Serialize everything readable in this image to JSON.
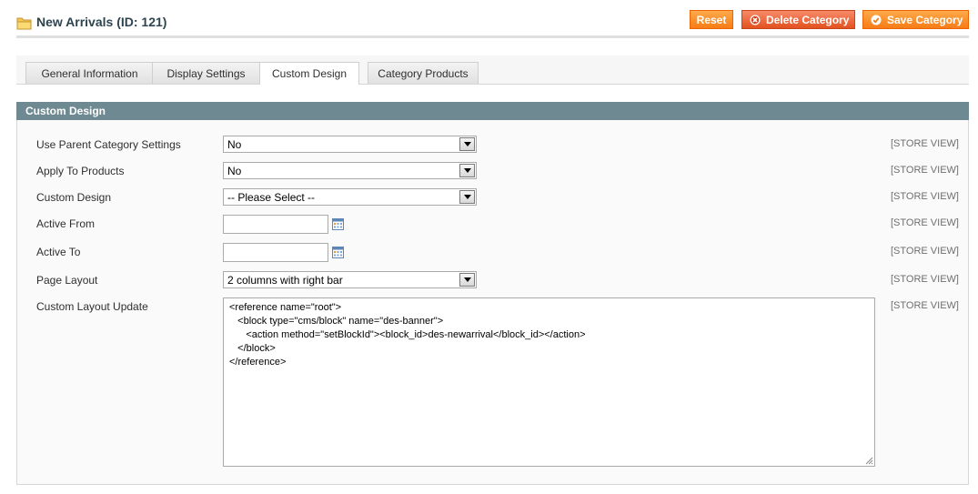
{
  "header": {
    "title": "New Arrivals (ID: 121)",
    "title_icon": "folder-icon",
    "buttons": {
      "reset": "Reset",
      "delete": "Delete Category",
      "save": "Save Category"
    }
  },
  "tabs": [
    {
      "label": "General Information",
      "active": false
    },
    {
      "label": "Display Settings",
      "active": false
    },
    {
      "label": "Custom Design",
      "active": true
    },
    {
      "label": "Category Products",
      "active": false
    }
  ],
  "section": {
    "title": "Custom Design",
    "scope_label": "[STORE VIEW]",
    "fields": {
      "use_parent": {
        "label": "Use Parent Category Settings",
        "value": "No"
      },
      "apply_products": {
        "label": "Apply To Products",
        "value": "No"
      },
      "custom_design": {
        "label": "Custom Design",
        "value": "-- Please Select --"
      },
      "active_from": {
        "label": "Active From",
        "value": ""
      },
      "active_to": {
        "label": "Active To",
        "value": ""
      },
      "page_layout": {
        "label": "Page Layout",
        "value": "2 columns with right bar"
      },
      "layout_update": {
        "label": "Custom Layout Update",
        "value": "<reference name=\"root\">\n   <block type=\"cms/block\" name=\"des-banner\">\n      <action method=\"setBlockId\"><block_id>des-newarrival</block_id></action>\n   </block>\n</reference>"
      }
    }
  },
  "colors": {
    "section_header": "#6f8992",
    "button_orange": "#f77c16",
    "button_red": "#e2521f"
  }
}
